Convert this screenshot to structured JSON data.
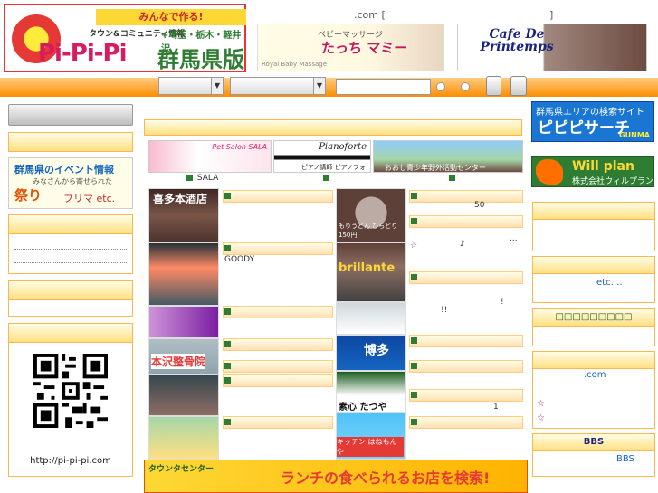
{
  "header": {
    "logo": {
      "tagline": "みんなで作る!",
      "subtitle": "タウン&コミュニティ情報",
      "brand": "Pi-Pi-Pi",
      "regions": "+埼玉・栃木・軽井沢",
      "prefecture": "群馬県版"
    },
    "domain_prefix": ".com [",
    "domain_suffix": "]",
    "ad_massage": {
      "small": "ベビーマッサージ",
      "name": "たっち マミー",
      "footer": "Royal Baby Massage"
    },
    "ad_cafe": {
      "name": "Cafe De Printemps"
    }
  },
  "nav": {
    "select1": "",
    "select2": "",
    "search_placeholder": ""
  },
  "left": {
    "event": {
      "title": "群馬県のイベント情報",
      "sub": "みなさんから寄せられた",
      "main": "祭り",
      "main2": "フリマ etc."
    },
    "qr_url": "http://pi-pi-pi.com"
  },
  "center": {
    "featured": [
      {
        "name": "Pet Salon SALA",
        "caption": "SALA"
      },
      {
        "name": "Pianoforte",
        "caption": "ピアノ講師 ピアノフォルテ"
      },
      {
        "name": "おおし青少年野外活動センター",
        "caption": ""
      }
    ],
    "thumbs_left": [
      "喜多本酒店",
      "",
      "",
      "",
      "本沢整骨院",
      "",
      ""
    ],
    "thumbs_right": [
      "もりうどん ひらどり150円",
      "brillante",
      "",
      "博多",
      "素心 たつや",
      "キッチン はねもんや"
    ],
    "texts": {
      "r1": "50",
      "r2": "...",
      "r3": "☆",
      "r3b": "♪",
      "goody": "GOODY",
      "ex1": "!",
      "ex2": "!!",
      "one": "1"
    },
    "banner": {
      "small": "タウンタセンター",
      "text": "ランチの食べられるお店を検索!"
    }
  },
  "right": {
    "pipipi_search": {
      "top": "群馬県エリアの検索サイト",
      "main": "ピピピサーチ",
      "sub": "GUNMA"
    },
    "willplan": {
      "name": "Will plan",
      "company": "株式会社ウィルプラン"
    },
    "etc": "etc.…",
    "green_link": "□□□□□□□□□",
    "com": ".com",
    "stars": [
      "☆",
      "☆"
    ],
    "bbs_title": "BBS",
    "bbs_link": "BBS"
  },
  "colors": {
    "accent": "#fb8c00",
    "panel": "#ffe082",
    "link": "#1565c0",
    "bullet": "#2e7d32"
  }
}
